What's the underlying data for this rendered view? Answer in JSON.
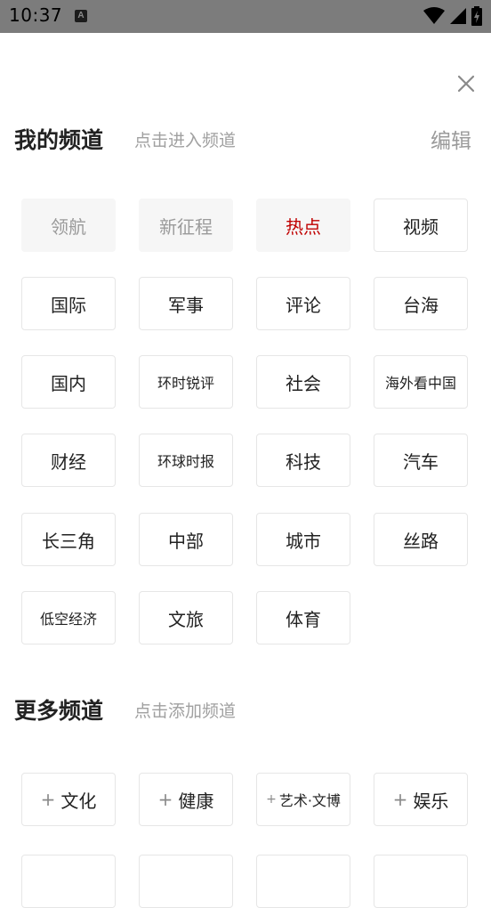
{
  "status_bar": {
    "time": "10:37",
    "notification_letter": "A"
  },
  "my_channels": {
    "title": "我的频道",
    "hint": "点击进入频道",
    "edit_label": "编辑",
    "items": [
      "领航",
      "新征程",
      "热点",
      "视频",
      "国际",
      "军事",
      "评论",
      "台海",
      "国内",
      "环时锐评",
      "社会",
      "海外看中国",
      "财经",
      "环球时报",
      "科技",
      "汽车",
      "长三角",
      "中部",
      "城市",
      "丝路",
      "低空经济",
      "文旅",
      "体育"
    ]
  },
  "more_channels": {
    "title": "更多频道",
    "hint": "点击添加频道",
    "plus_symbol": "+",
    "items": [
      "文化",
      "健康",
      "艺术·文博",
      "娱乐"
    ]
  }
}
